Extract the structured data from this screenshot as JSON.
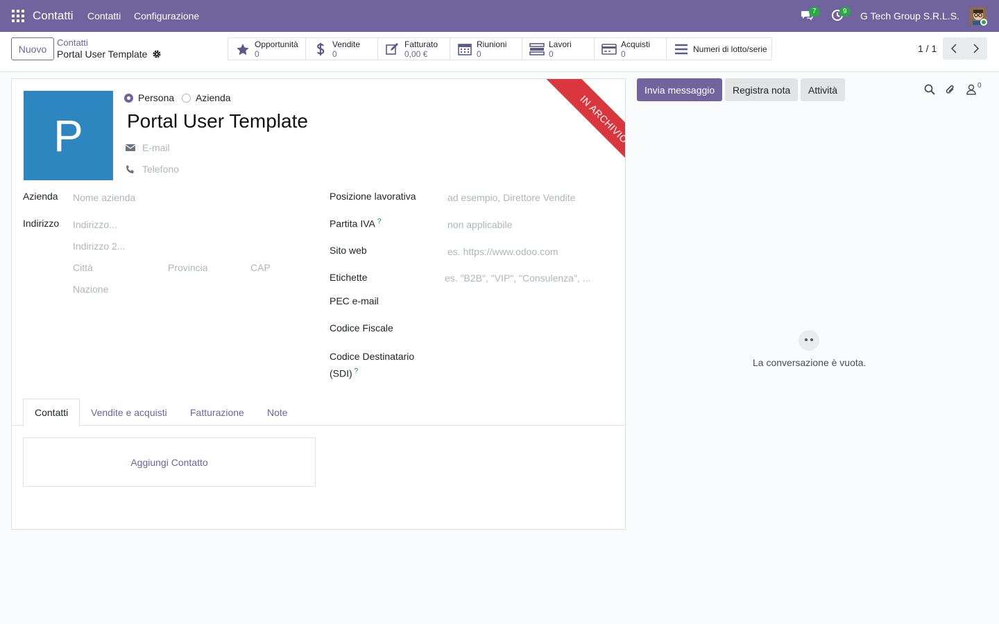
{
  "navbar": {
    "app_name": "Contatti",
    "menu": [
      "Contatti",
      "Configurazione"
    ],
    "messages_count": "7",
    "activities_count": "9",
    "company": "G Tech Group S.R.L.S."
  },
  "control": {
    "new_label": "Nuovo",
    "breadcrumb_parent": "Contatti",
    "breadcrumb_current": "Portal User Template",
    "pager": "1 / 1",
    "stats": [
      {
        "label": "Opportunità",
        "value": "0",
        "icon": "star-icon"
      },
      {
        "label": "Vendite",
        "value": "0",
        "icon": "dollar-icon"
      },
      {
        "label": "Fatturato",
        "value": "0,00 €",
        "icon": "edit-icon"
      },
      {
        "label": "Riunioni",
        "value": "0",
        "icon": "calendar-icon"
      },
      {
        "label": "Lavori",
        "value": "0",
        "icon": "tasks-icon"
      },
      {
        "label": "Acquisti",
        "value": "0",
        "icon": "credit-card-icon"
      },
      {
        "label": "Numeri di lotto/serie",
        "value": "",
        "icon": "list-icon"
      }
    ]
  },
  "form": {
    "avatar_letter": "P",
    "type_person": "Persona",
    "type_company": "Azienda",
    "name": "Portal User Template",
    "email_placeholder": "E-mail",
    "phone_placeholder": "Telefono",
    "ribbon": "IN ARCHIVIO",
    "left_fields": {
      "company_label": "Azienda",
      "company_placeholder": "Nome azienda",
      "address_label": "Indirizzo",
      "street_placeholder": "Indirizzo...",
      "street2_placeholder": "Indirizzo 2...",
      "city_placeholder": "Città",
      "province_placeholder": "Provincia",
      "zip_placeholder": "CAP",
      "country_placeholder": "Nazione"
    },
    "right_fields": {
      "job_label": "Posizione lavorativa",
      "job_placeholder": "ad esempio, Direttore Vendite",
      "vat_label": "Partita IVA",
      "vat_placeholder": "non applicabile",
      "website_label": "Sito web",
      "website_placeholder": "es. https://www.odoo.com",
      "tags_label": "Etichette",
      "tags_placeholder": "es. \"B2B\", \"VIP\", \"Consulenza\", ...",
      "pec_label": "PEC e-mail",
      "fiscal_label": "Codice Fiscale",
      "sdi_label_1": "Codice Destinatario",
      "sdi_label_2": "(SDI)",
      "help_mark": "?"
    },
    "tabs": [
      "Contatti",
      "Vendite e acquisti",
      "Fatturazione",
      "Note"
    ],
    "add_contact": "Aggiungi Contatto"
  },
  "chatter": {
    "send_message": "Invia messaggio",
    "log_note": "Registra nota",
    "activities": "Attività",
    "followers_count": "0",
    "empty_text": "La conversazione è vuota."
  }
}
